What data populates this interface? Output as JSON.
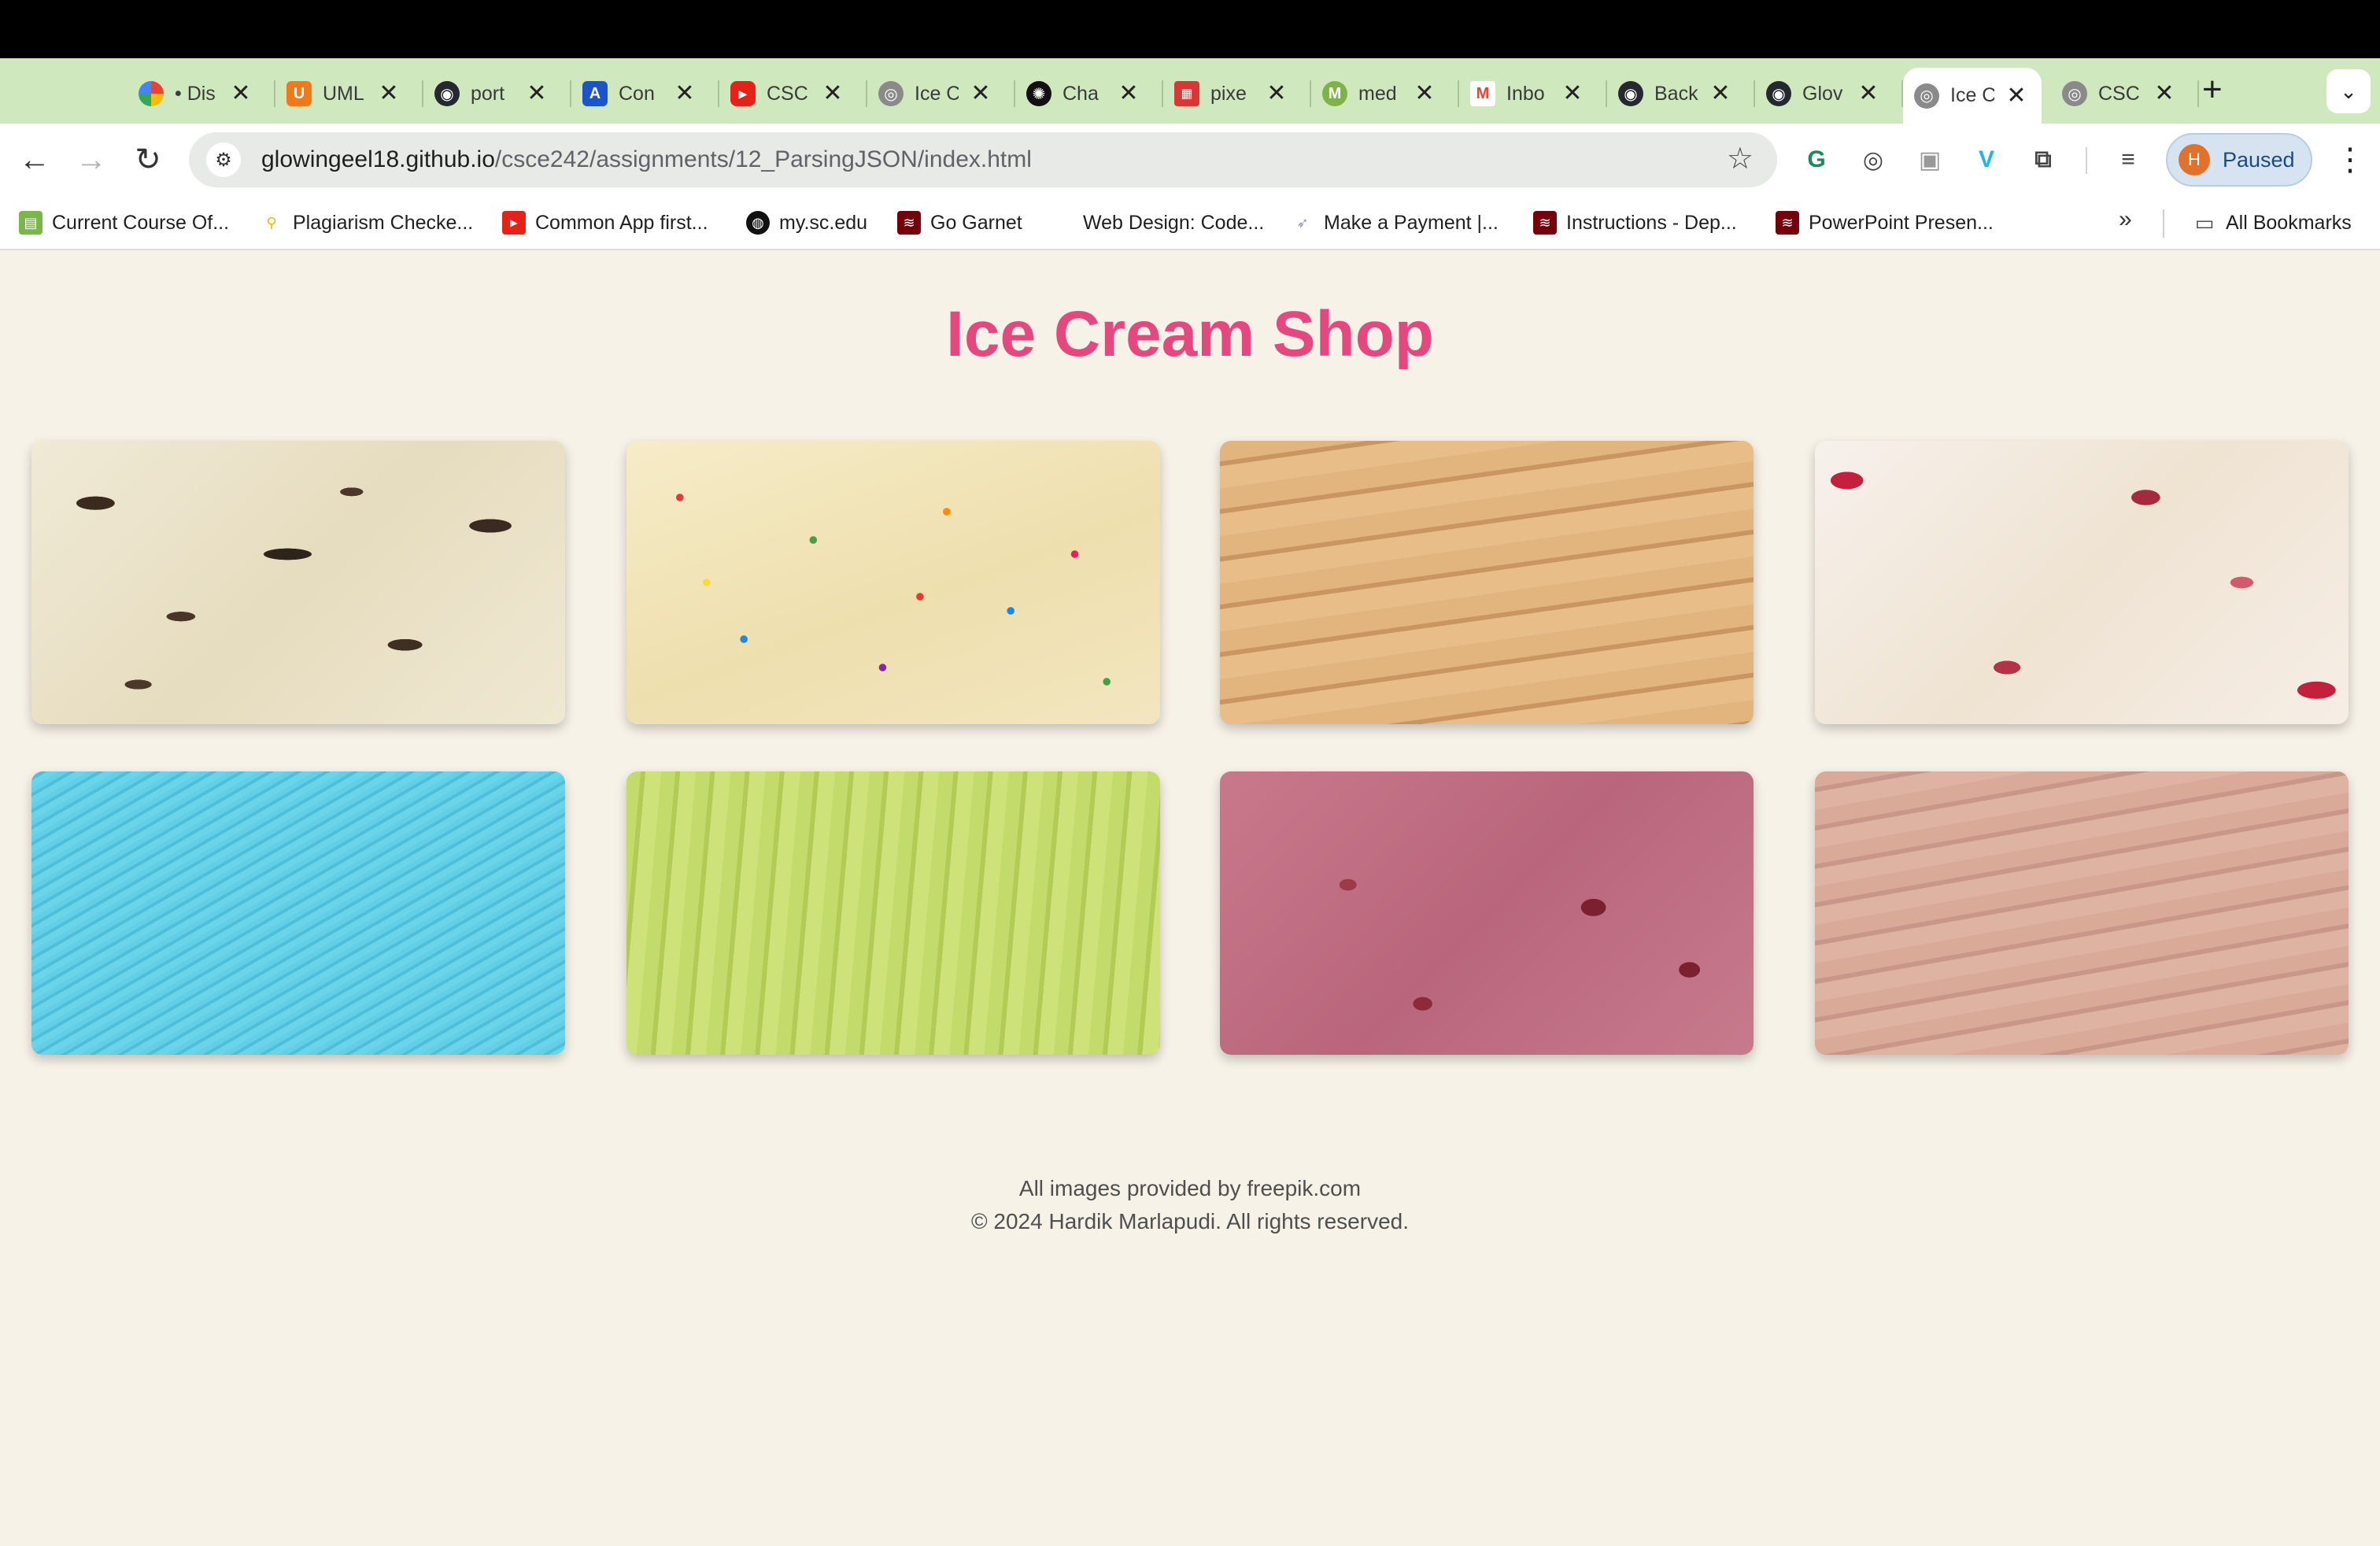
{
  "browser": {
    "tabs": [
      {
        "title": "• Dis",
        "favicon": "google-icon",
        "color": "#4285f4"
      },
      {
        "title": "UML",
        "favicon": "umlet-icon",
        "color": "#f07a1a"
      },
      {
        "title": "port",
        "favicon": "github-icon",
        "color": "#24292f"
      },
      {
        "title": "Con",
        "favicon": "app-a-icon",
        "color": "#1a56c9"
      },
      {
        "title": "CSC",
        "favicon": "youtube-icon",
        "color": "#e62117"
      },
      {
        "title": "Ice C",
        "favicon": "globe-icon",
        "color": "#8a8a8a"
      },
      {
        "title": "Cha",
        "favicon": "chatgpt-icon",
        "color": "#111111"
      },
      {
        "title": "pixe",
        "favicon": "pixel-icon",
        "color": "#d93636"
      },
      {
        "title": "med",
        "favicon": "mediavine-icon",
        "color": "#7fb34a"
      },
      {
        "title": "Inbo",
        "favicon": "gmail-icon",
        "color": "#ea4335"
      },
      {
        "title": "Back",
        "favicon": "github-icon",
        "color": "#24292f"
      },
      {
        "title": "Glov",
        "favicon": "github-icon",
        "color": "#24292f"
      },
      {
        "title": "Ice C",
        "favicon": "globe-icon",
        "color": "#8a8a8a",
        "active": true
      },
      {
        "title": "CSC",
        "favicon": "globe-icon",
        "color": "#8a8a8a"
      }
    ],
    "url_host": "glowingeel18.github.io",
    "url_path": "/csce242/assignments/12_ParsingJSON/index.html",
    "profile_initial": "H",
    "profile_label": "Paused",
    "bookmarks": [
      {
        "label": "Current Course Of...",
        "icon": "course-icon",
        "color": "#7ab648"
      },
      {
        "label": "Plagiarism Checke...",
        "icon": "magnifier-icon",
        "color": "#f2b705"
      },
      {
        "label": "Common App first...",
        "icon": "youtube-icon",
        "color": "#e62117"
      },
      {
        "label": "my.sc.edu",
        "icon": "globe-icon",
        "color": "#111111"
      },
      {
        "label": "Go Garnet",
        "icon": "usc-icon",
        "color": "#73000a"
      },
      {
        "label": "Web Design: Code...",
        "icon": "blank-icon",
        "color": "#ffffff"
      },
      {
        "label": "Make a Payment |...",
        "icon": "payment-icon",
        "color": "#8899aa"
      },
      {
        "label": "Instructions - Dep...",
        "icon": "usc-icon",
        "color": "#73000a"
      },
      {
        "label": "PowerPoint Presen...",
        "icon": "usc-icon",
        "color": "#73000a"
      }
    ],
    "all_bookmarks": "All Bookmarks"
  },
  "page": {
    "title": "Ice Cream Shop",
    "title_color": "#e5477f",
    "background": "#f7f2e8",
    "flavors": [
      {
        "image": "cookies-and-cream-image"
      },
      {
        "image": "birthday-cake-image"
      },
      {
        "image": "peanut-butter-image"
      },
      {
        "image": "cherry-vanilla-image"
      },
      {
        "image": "blue-moon-image"
      },
      {
        "image": "pistachio-image"
      },
      {
        "image": "black-raspberry-image"
      },
      {
        "image": "chocolate-image"
      }
    ],
    "footer_credit": "All images provided by freepik.com",
    "footer_copyright": "© 2024 Hardik Marlapudi. All rights reserved."
  }
}
